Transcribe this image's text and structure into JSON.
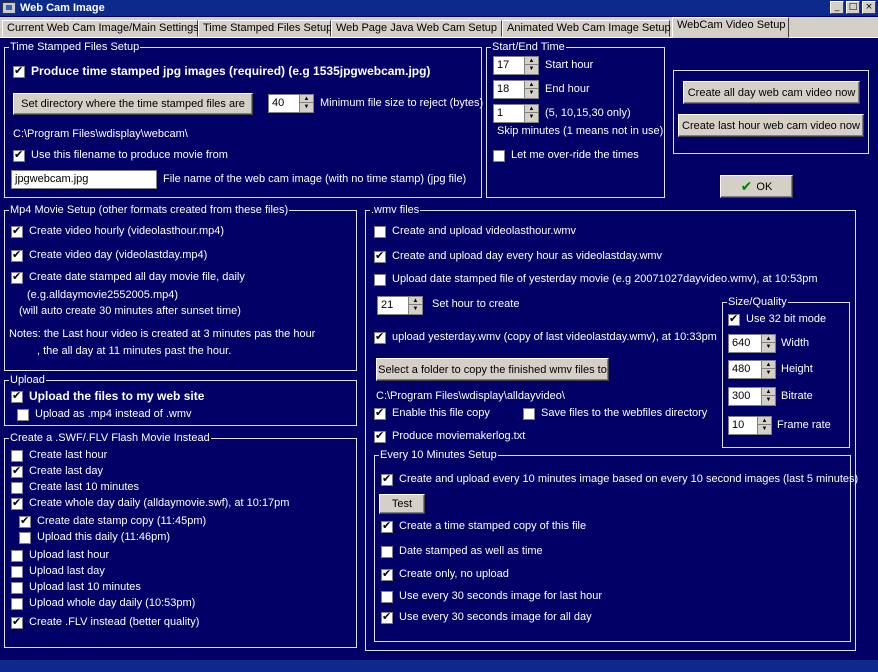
{
  "window": {
    "title": "Web Cam Image",
    "min": "_",
    "max": "□",
    "close": "×"
  },
  "tabs": [
    {
      "label": "Current Web Cam Image/Main Settings"
    },
    {
      "label": "Time Stamped Files Setup"
    },
    {
      "label": "Web Page Java Web Cam Setup"
    },
    {
      "label": "Animated Web Cam Image Setup"
    },
    {
      "label": "WebCam Video Setup"
    }
  ],
  "tsf": {
    "title": "Time Stamped Files Setup",
    "produce_label": "Produce time stamped jpg images (required) (e.g 1535jpgwebcam.jpg)",
    "setdir_button": "Set directory where the time stamped files are",
    "minsize_value": "40",
    "minsize_label": "Minimum file size to reject (bytes)",
    "path": "C:\\Program Files\\wdisplay\\webcam\\",
    "use_filename_label": "Use this filename to produce movie from",
    "filename_value": "jpgwebcam.jpg",
    "filename_label": "File name of the web cam image (with no time stamp) (jpg file)"
  },
  "startend": {
    "title": "Start/End Time",
    "start_value": "17",
    "start_label": "Start hour",
    "end_value": "18",
    "end_label": "End hour",
    "skip_value": "1",
    "skip_hint": "(5, 10,15,30 only)",
    "skip_label": "Skip minutes (1 means not in use)",
    "override_label": "Let me over-ride the times"
  },
  "create_buttons": {
    "allday": "Create all day web cam video now",
    "lasthour": "Create last hour web cam video now"
  },
  "ok_button": "OK",
  "mp4": {
    "title": "Mp4 Movie Setup (other formats created from these files)",
    "hourly": "Create video hourly (videolasthour.mp4)",
    "day": "Create video day  (videolastday.mp4)",
    "datestamped": "Create date stamped all day movie file, daily",
    "example": "(e.g.alldaymovie2552005.mp4)",
    "auto": "(will auto create 30 minutes after sunset time)",
    "note1": "Notes: the Last hour video is created at 3 minutes pas the hour",
    "note2": ", the all day at 11 minutes past the hour."
  },
  "upload": {
    "title": "Upload",
    "upload_label": "Upload the files to my web site",
    "mp4_label": "Upload as .mp4 instead of .wmv"
  },
  "swf": {
    "title": "Create a .SWF/.FLV Flash Movie Instead",
    "items": [
      "Create last hour",
      "Create last day",
      "Create last 10 minutes",
      "Create whole day daily    (alldaymovie.swf), at 10:17pm",
      "Create date stamp copy (11:45pm)",
      "Upload this daily (11:46pm)",
      "Upload last hour",
      "Upload last day",
      "Upload last 10 minutes",
      "Upload whole day daily (10:53pm)",
      "Create .FLV instead (better quality)"
    ]
  },
  "wmv": {
    "title": ".wmv files",
    "lasthour": "Create and upload videolasthour.wmv",
    "lastday": "Create and upload day every hour as videolastday.wmv",
    "datestamped": "Upload date stamped file of yesterday movie (e.g 20071027dayvideo.wmv), at 10:53pm",
    "hour_value": "21",
    "hour_label": "Set hour to create",
    "yesterday": "upload yesterday.wmv (copy of last videolastday.wmv), at 10:33pm",
    "folder_button": "Select a folder to copy the finished wmv files to",
    "folder_path": "C:\\Program Files\\wdisplay\\alldayvideo\\",
    "enable_copy": "Enable this file copy",
    "save_webfiles": "Save files to the webfiles directory",
    "log": "Produce moviemakerlog.txt"
  },
  "size": {
    "title": "Size/Quality",
    "use32": "Use 32 bit mode",
    "width_value": "640",
    "width_label": "Width",
    "height_value": "480",
    "height_label": "Height",
    "bitrate_value": "300",
    "bitrate_label": "Bitrate",
    "framerate_value": "10",
    "framerate_label": "Frame rate"
  },
  "ten": {
    "title": "Every 10 Minutes Setup",
    "create_upload": "Create and upload every 10 minutes image based on every 10 second images (last 5 minutes)",
    "test_button": "Test",
    "timestamped_copy": "Create a time stamped copy of this file",
    "date_time": "Date stamped as well as time",
    "create_only": "Create only, no upload",
    "every30_hour": "Use every 30 seconds image for last hour",
    "every30_day": "Use every 30 seconds image for all day"
  }
}
